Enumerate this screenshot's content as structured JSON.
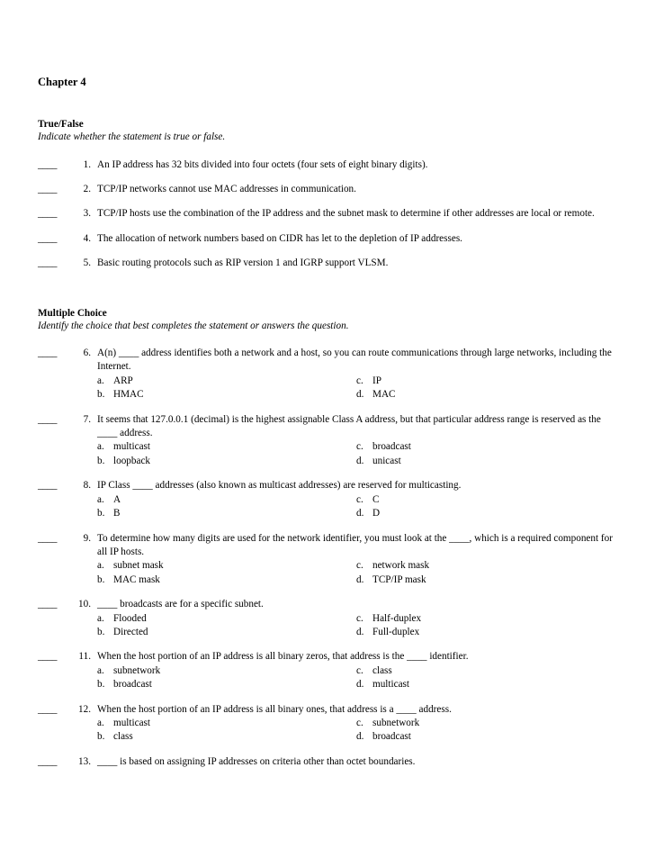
{
  "document": {
    "title": "Chapter 4",
    "blank_marker": "____"
  },
  "sections": [
    {
      "heading": "True/False",
      "instruction": "Indicate whether the statement is true or false."
    },
    {
      "heading": "Multiple Choice",
      "instruction": "Identify the choice that best completes the statement or answers the question."
    }
  ],
  "true_false": {
    "heading": "True/False",
    "instruction": "Indicate whether the statement is true or false.",
    "questions": [
      {
        "number": "1.",
        "blank": "____",
        "text": "An IP address has 32 bits divided into four octets (four sets of eight binary digits)."
      },
      {
        "number": "2.",
        "blank": "____",
        "text": "TCP/IP networks cannot use MAC addresses in communication."
      },
      {
        "number": "3.",
        "blank": "____",
        "text": "TCP/IP hosts use the combination of the IP address and the subnet mask to determine if other addresses are local or remote."
      },
      {
        "number": "4.",
        "blank": "____",
        "text": "The allocation of network numbers based on CIDR has let to the depletion of IP addresses."
      },
      {
        "number": "5.",
        "blank": "____",
        "text": "Basic routing protocols such as RIP version 1 and IGRP support VLSM."
      }
    ]
  },
  "multiple_choice": {
    "heading": "Multiple Choice",
    "instruction": "Identify the choice that best completes the statement or answers the question.",
    "questions": [
      {
        "number": "6.",
        "blank": "____",
        "text": "A(n) ____ address identifies both a network and a host, so you can route communications through large networks, including the Internet.",
        "options": [
          {
            "letter": "a.",
            "text": "ARP"
          },
          {
            "letter": "b.",
            "text": "HMAC"
          },
          {
            "letter": "c.",
            "text": "IP"
          },
          {
            "letter": "d.",
            "text": "MAC"
          }
        ]
      },
      {
        "number": "7.",
        "blank": "____",
        "text": "It seems that 127.0.0.1 (decimal) is the highest assignable Class A address, but that particular address range is reserved as the ____ address.",
        "options": [
          {
            "letter": "a.",
            "text": "multicast"
          },
          {
            "letter": "b.",
            "text": "loopback"
          },
          {
            "letter": "c.",
            "text": "broadcast"
          },
          {
            "letter": "d.",
            "text": "unicast"
          }
        ]
      },
      {
        "number": "8.",
        "blank": "____",
        "text": "IP Class ____ addresses (also known as multicast addresses) are reserved for multicasting.",
        "options": [
          {
            "letter": "a.",
            "text": "A"
          },
          {
            "letter": "b.",
            "text": "B"
          },
          {
            "letter": "c.",
            "text": "C"
          },
          {
            "letter": "d.",
            "text": "D"
          }
        ]
      },
      {
        "number": "9.",
        "blank": "____",
        "text": "To determine how many digits are used for the network identifier, you must look at the ____, which is a required component for all IP hosts.",
        "options": [
          {
            "letter": "a.",
            "text": "subnet mask"
          },
          {
            "letter": "b.",
            "text": "MAC mask"
          },
          {
            "letter": "c.",
            "text": "network mask"
          },
          {
            "letter": "d.",
            "text": "TCP/IP mask"
          }
        ]
      },
      {
        "number": "10.",
        "blank": "____",
        "text": "____ broadcasts are for a specific subnet.",
        "options": [
          {
            "letter": "a.",
            "text": "Flooded"
          },
          {
            "letter": "b.",
            "text": "Directed"
          },
          {
            "letter": "c.",
            "text": "Half-duplex"
          },
          {
            "letter": "d.",
            "text": "Full-duplex"
          }
        ]
      },
      {
        "number": "11.",
        "blank": "____",
        "text": "When the host portion of an IP address is all binary zeros, that address is the ____ identifier.",
        "options": [
          {
            "letter": "a.",
            "text": "subnetwork"
          },
          {
            "letter": "b.",
            "text": "broadcast"
          },
          {
            "letter": "c.",
            "text": "class"
          },
          {
            "letter": "d.",
            "text": "multicast"
          }
        ]
      },
      {
        "number": "12.",
        "blank": "____",
        "text": "When the host portion of an IP address is all binary ones, that address is a ____ address.",
        "options": [
          {
            "letter": "a.",
            "text": "multicast"
          },
          {
            "letter": "b.",
            "text": "class"
          },
          {
            "letter": "c.",
            "text": "subnetwork"
          },
          {
            "letter": "d.",
            "text": "broadcast"
          }
        ]
      },
      {
        "number": "13.",
        "blank": "____",
        "text": "____ is based on assigning IP addresses on criteria other than octet boundaries.",
        "options": []
      }
    ]
  }
}
